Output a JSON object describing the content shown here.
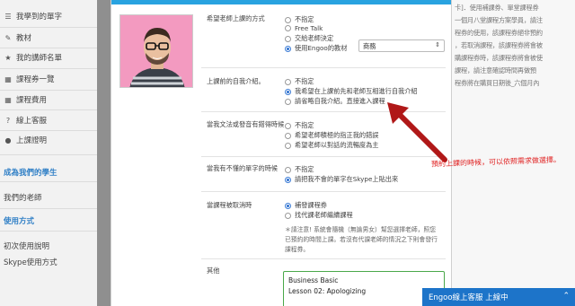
{
  "sidebar": {
    "items": [
      {
        "icon": "list-icon",
        "glyph": "☰",
        "label": "我學到的單字"
      },
      {
        "icon": "book-icon",
        "glyph": "✎",
        "label": "教材"
      },
      {
        "icon": "star-icon",
        "glyph": "★",
        "label": "我的講師名單"
      },
      {
        "icon": "grid-icon",
        "glyph": "▦",
        "label": "課程券一覽"
      },
      {
        "icon": "grid-icon",
        "glyph": "▦",
        "label": "課程費用"
      },
      {
        "icon": "help-icon",
        "glyph": "?",
        "label": "線上客服"
      },
      {
        "icon": "dot-icon",
        "glyph": "●",
        "label": "上課證明"
      }
    ],
    "section1_title": "成為我們的學生",
    "section1_links": [
      "我們的老師"
    ],
    "section2_title": "使用方式",
    "section2_links": [
      "初次使用說明",
      "Skype使用方式"
    ]
  },
  "right_panel": {
    "lines": [
      "卡]．使用補課券、單堂課程券",
      "一個月八堂課程方案學員，請注",
      "程券的使用，該課程券絕非預約",
      "，若取消課程，該課程券將會被",
      "購課程券時，該課程券將會被使",
      "課程，請注意確認時間再做預",
      "程券將在購買日期後_六個月內"
    ]
  },
  "modal": {
    "q_teaching_style": "希望老師上課的方式",
    "teaching_options": [
      "不指定",
      "Free Talk",
      "交給老師決定",
      "使用Engoo的教材"
    ],
    "teaching_selected": 3,
    "course_select_value": "商務",
    "q_self_intro": "上課前的自我介紹。",
    "intro_options": [
      "不指定",
      "我希望在上課前先和老師互相進行自我介紹",
      "請省略自我介紹。直接進入課程"
    ],
    "intro_selected": 1,
    "q_grammar": "當我文法或發音有錯得時候",
    "grammar_options": [
      "不指定",
      "希望老師積極的指正我的錯誤",
      "希望老師以對話的流暢度為主"
    ],
    "grammar_selected": 0,
    "q_unknown_word": "當我有不懂的單字的時候",
    "word_options": [
      "不指定",
      "請把我不會的單字在Skype上貼出來"
    ],
    "word_selected": 1,
    "q_cancel": "當課程被取消時",
    "cancel_options": [
      "補發課程券",
      "找代課老師繼續課程"
    ],
    "cancel_selected": 0,
    "note_lines": [
      "＊請注意! 系統會隨機（無論男女）幫您選擇老師，照您",
      "已預約的時間上課。若沒有代課老師的情況之下則會發行",
      "課程券。"
    ],
    "other_label": "其他",
    "other_text_lines": [
      "Business Basic",
      "Lesson 02: Apologizing"
    ]
  },
  "annotation": "預約上課的時候，可以依照需求做選擇。",
  "chat": {
    "label": "Engoo線上客服 上線中",
    "icon": "chevron-up-icon"
  },
  "colors": {
    "accent": "#29a3e0",
    "link_blue": "#2f7fc6",
    "annotation_red": "#c81e1e",
    "chat_blue": "#1d74c9"
  }
}
